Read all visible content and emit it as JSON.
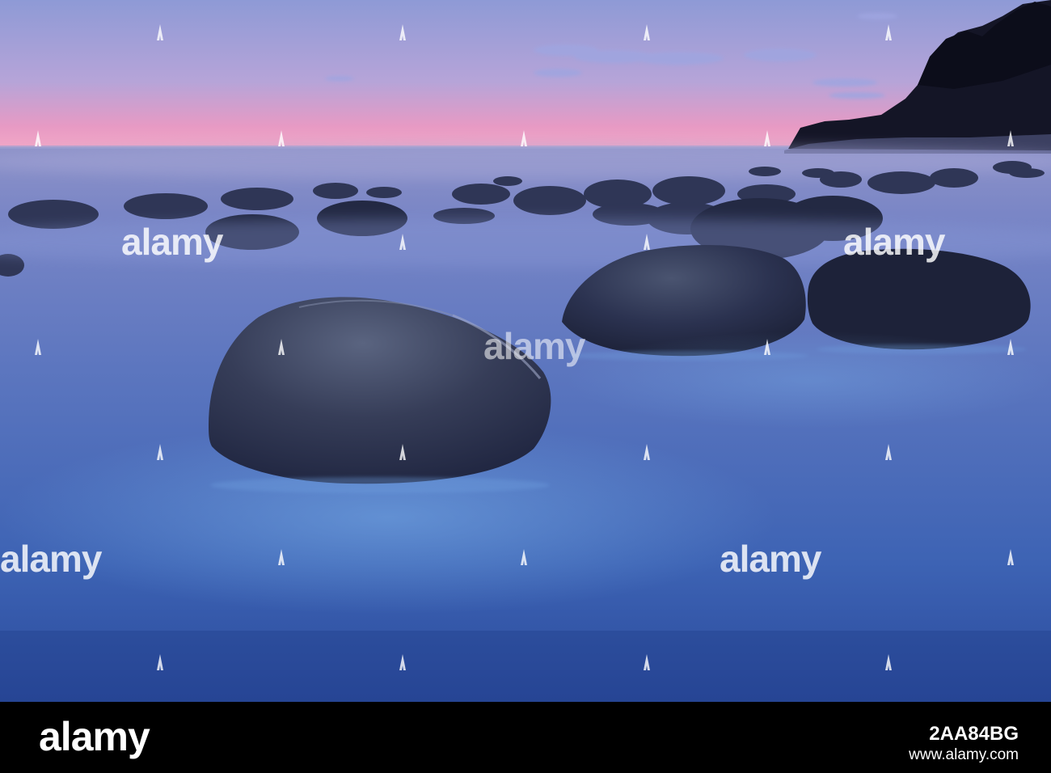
{
  "scene": {
    "subject": "rounded boulders in misty long-exposure sea at twilight",
    "palette": {
      "sky_top": "#8e9ad6",
      "sky_pink": "#e79ac4",
      "horizon": "#f2a7c6",
      "sea_far": "#8d92c8",
      "sea_mid": "#5c76bf",
      "sea_near": "#3d63b4",
      "sea_bottom": "#2a4a9c",
      "rock": "#2b3250",
      "rock_dark": "#1b2036",
      "cliff": "#141526"
    }
  },
  "watermark": {
    "word": "alamy",
    "mark_icon": "alamy-mark-icon"
  },
  "stock_bar": {
    "logo": "alamy",
    "image_id": "2AA84BG",
    "site": "www.alamy.com"
  }
}
